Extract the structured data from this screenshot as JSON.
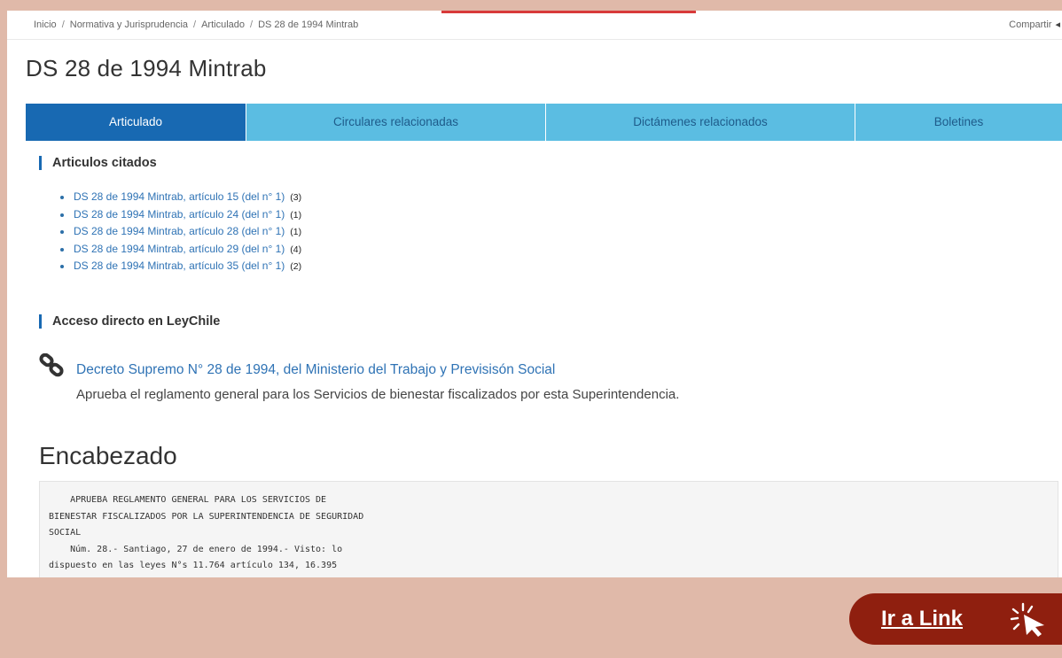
{
  "breadcrumb": {
    "items": [
      "Inicio",
      "Normativa y Jurisprudencia",
      "Articulado",
      "DS 28 de 1994 Mintrab"
    ],
    "separator": "/"
  },
  "share": {
    "label": "Compartir",
    "icon": "share-icon"
  },
  "page_title": "DS 28 de 1994 Mintrab",
  "tabs": [
    {
      "label": "Articulado",
      "active": true
    },
    {
      "label": "Circulares relacionadas",
      "active": false
    },
    {
      "label": "Dictámenes relacionados",
      "active": false
    },
    {
      "label": "Boletines",
      "active": false
    }
  ],
  "articulos": {
    "heading": "Articulos citados",
    "items": [
      {
        "label": "DS 28 de 1994 Mintrab, artículo 15 (del n° 1)",
        "count": "(3)"
      },
      {
        "label": "DS 28 de 1994 Mintrab, artículo 24 (del n° 1)",
        "count": "(1)"
      },
      {
        "label": "DS 28 de 1994 Mintrab, artículo 28 (del n° 1)",
        "count": "(1)"
      },
      {
        "label": "DS 28 de 1994 Mintrab, artículo 29 (del n° 1)",
        "count": "(4)"
      },
      {
        "label": "DS 28 de 1994 Mintrab, artículo 35 (del n° 1)",
        "count": "(2)"
      }
    ]
  },
  "leychile": {
    "heading": "Acceso directo en LeyChile",
    "link": "Decreto Supremo N° 28 de 1994, del Ministerio del Trabajo y Previsisón Social",
    "description": "Aprueba el reglamento general para los Servicios de bienestar fiscalizados por esta Superintendencia."
  },
  "encabezado": {
    "heading": "Encabezado",
    "text": "    APRUEBA REGLAMENTO GENERAL PARA LOS SERVICIOS DE\nBIENESTAR FISCALIZADOS POR LA SUPERINTENDENCIA DE SEGURIDAD\nSOCIAL\n    Núm. 28.- Santiago, 27 de enero de 1994.- Visto: lo\ndispuesto en las leyes N°s 11.764 artículo 134, 16.395"
  },
  "cta": {
    "label": "Ir a Link",
    "icon": "cursor-click-icon"
  },
  "colors": {
    "background": "#e0b9a9",
    "tab_active": "#1869b2",
    "tab_inactive": "#5bbde2",
    "link": "#2f73b5",
    "cta": "#8f1f0f"
  }
}
